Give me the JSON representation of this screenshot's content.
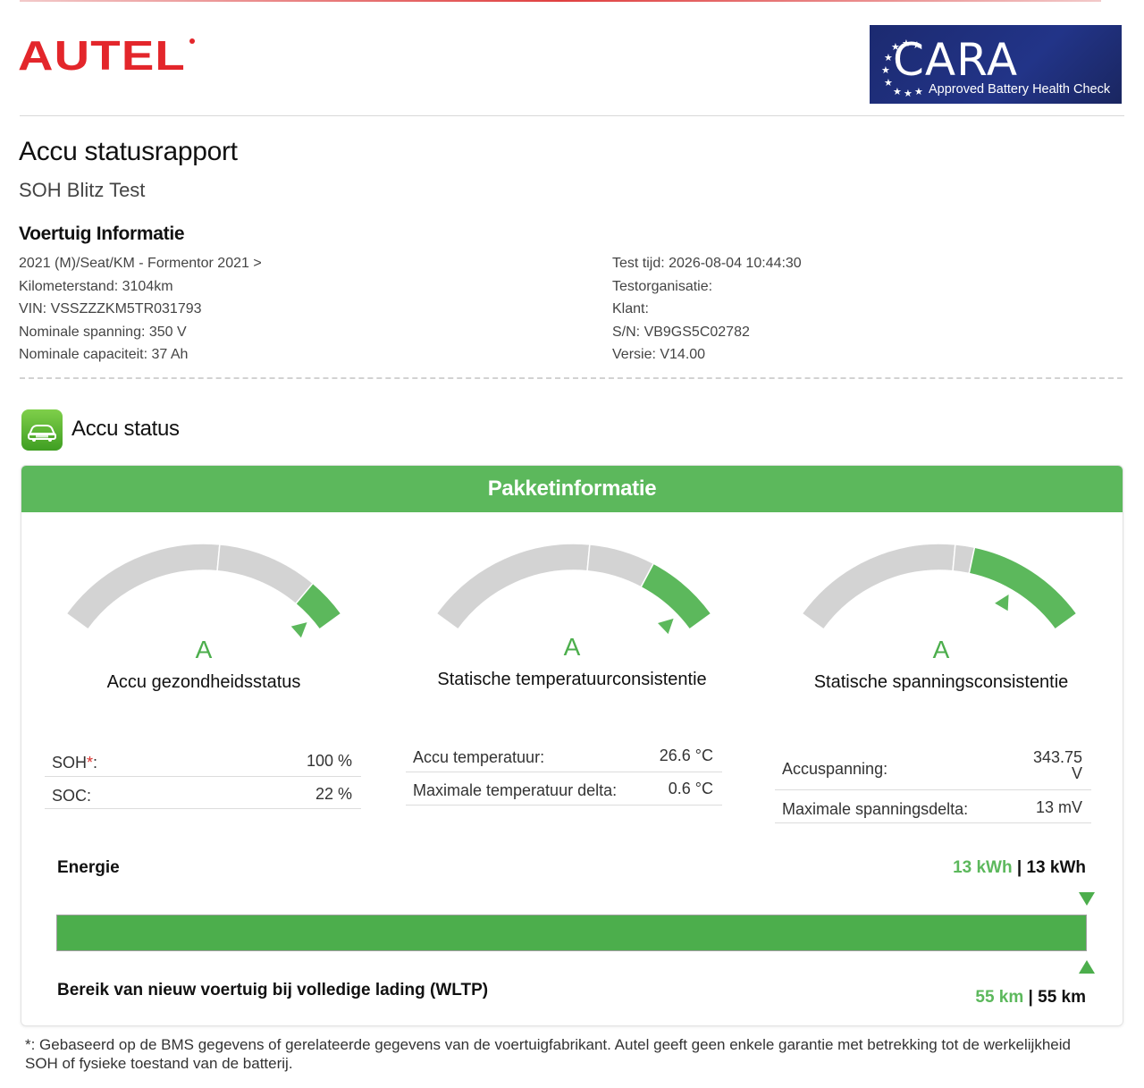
{
  "header": {
    "logo_text": "AUTEL",
    "cara_title": "CARA",
    "cara_subtitle": "Approved Battery Health Check"
  },
  "report": {
    "title": "Accu statusrapport",
    "subtitle": "SOH Blitz Test",
    "vehicle_heading": "Voertuig Informatie"
  },
  "vehicle_left": [
    "2021 (M)/Seat/KM - Formentor 2021 >",
    "Kilometerstand: 3104km",
    "VIN: VSSZZZKM5TR031793",
    "Nominale spanning: 350 V",
    "Nominale capaciteit: 37 Ah"
  ],
  "vehicle_right": [
    "Test tijd: 2026-08-04 10:44:30",
    "Testorganisatie:",
    "Klant:",
    "S/N: VB9GS5C02782",
    "Versie: V14.00"
  ],
  "status": {
    "title": "Accu status",
    "panel_title": "Pakketinformatie"
  },
  "gauges": [
    {
      "grade": "A",
      "label": "Accu gezondheidsstatus",
      "level": 0.95,
      "rows": [
        {
          "label": "SOH",
          "required_mark": "*",
          "suffix": ":",
          "value": "100 %"
        },
        {
          "label": "SOC:",
          "value": "22 %"
        }
      ]
    },
    {
      "grade": "A",
      "label": "Statische temperatuurconsistentie",
      "level": 0.93,
      "rows": [
        {
          "label": "Accu temperatuur:",
          "value": "26.6 °C"
        },
        {
          "label": "Maximale temperatuur delta:",
          "value": "0.6 °C"
        }
      ]
    },
    {
      "grade": "A",
      "label": "Statische spanningsconsistentie",
      "level": 0.78,
      "rows": [
        {
          "label": "Accuspanning:",
          "value_line1": "343.75",
          "value_line2": "V"
        },
        {
          "label": "Maximale spanningsdelta:",
          "value": "13 mV"
        }
      ]
    }
  ],
  "energy": {
    "label": "Energie",
    "current": "13 kWh",
    "separator": " | ",
    "total": "13 kWh",
    "fill_fraction": 1.0
  },
  "range": {
    "label": "Bereik van nieuw voertuig bij volledige lading (WLTP)",
    "current": "55 km",
    "separator": " | ",
    "total": "55 km"
  },
  "footnote": "*: Gebaseerd op de BMS gegevens of gerelateerde gegevens van de voertuigfabrikant. Autel geeft geen enkele garantie met betrekking tot de werkelijkheid SOH of fysieke toestand van de batterij.",
  "colors": {
    "brand_red": "#e3262b",
    "accent_green": "#5cb85c",
    "gauge_grey": "#d3d3d3",
    "cara_blue": "#1f2f7c"
  }
}
